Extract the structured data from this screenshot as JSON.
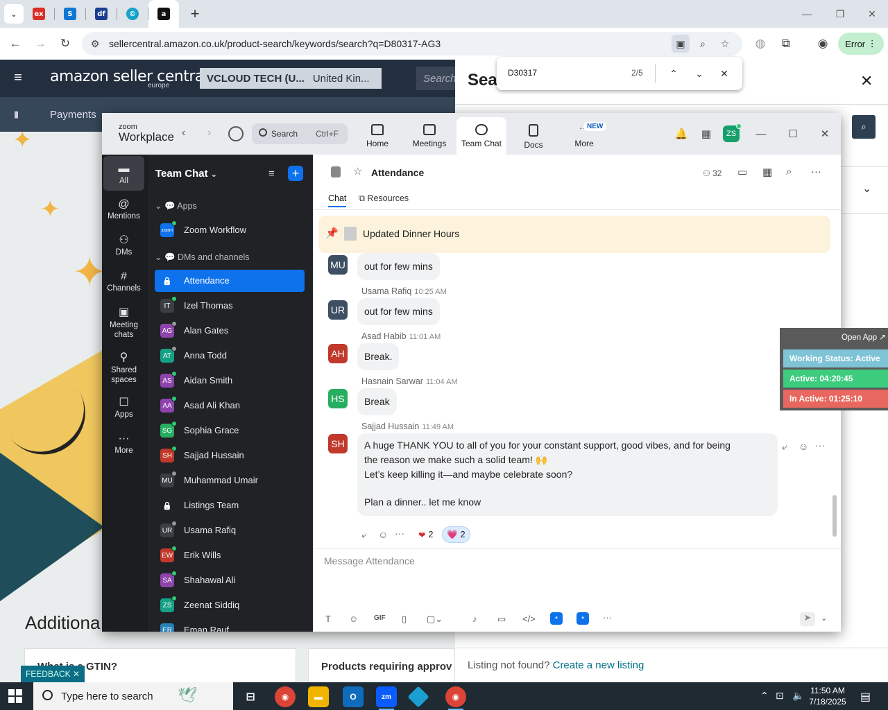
{
  "browser": {
    "tabs": [
      "ex",
      "sharepoint",
      "df",
      "copilot",
      "a"
    ],
    "new_tab": "+",
    "url": "sellercentral.amazon.co.uk/product-search/keywords/search?q=D80317-AG3",
    "error_label": "Error",
    "find": {
      "query": "D30317",
      "count": "2/5"
    }
  },
  "amazon": {
    "logo": "amazon seller central",
    "logo_sub": "europe",
    "account": "VCLOUD TECH (U...",
    "marketplace": "United Kin...",
    "search_placeholder": "Search",
    "nav_first": "Payments",
    "panel_title": "Sear",
    "additional": "Additiona",
    "card1": "What is a GTIN?",
    "card2": "Products requiring approv",
    "feedback": "FEEDBACK",
    "not_found": "Listing not found?",
    "create_link": "Create a new listing"
  },
  "zoom": {
    "brand_top": "zoom",
    "brand": "Workplace",
    "search_label": "Search",
    "search_shortcut": "Ctrl+F",
    "tabs": [
      {
        "label": "Home",
        "icon": "home-icon"
      },
      {
        "label": "Meetings",
        "icon": "video-icon"
      },
      {
        "label": "Team Chat",
        "icon": "chat-icon"
      },
      {
        "label": "Docs",
        "icon": "doc-icon"
      },
      {
        "label": "More",
        "icon": "more-icon"
      }
    ],
    "new_badge": "NEW",
    "user_initials": "ZS",
    "rail": [
      {
        "label": "All",
        "icon": "chat-bubble-icon"
      },
      {
        "label": "Mentions",
        "icon": "at-icon"
      },
      {
        "label": "DMs",
        "icon": "people-icon"
      },
      {
        "label": "Channels",
        "icon": "hash-icon"
      },
      {
        "label": "Meeting chats",
        "icon": "calendar-chat-icon"
      },
      {
        "label": "Shared spaces",
        "icon": "shared-icon"
      },
      {
        "label": "Apps",
        "icon": "apps-icon"
      },
      {
        "label": "More",
        "icon": "ellipsis-icon"
      }
    ],
    "sidebar": {
      "title": "Team Chat",
      "apps_section": "Apps",
      "dms_section": "DMs and channels",
      "apps": [
        {
          "label": "Zoom Workflow",
          "initials": "zoom",
          "color": "#0e72ed"
        }
      ],
      "items": [
        {
          "label": "Attendance",
          "initials": "",
          "color": "#0e72ed",
          "status": "",
          "active": true
        },
        {
          "label": "Izel Thomas",
          "initials": "IT",
          "color": "#3a3d42",
          "status": "#2ecc71"
        },
        {
          "label": "Alan Gates",
          "initials": "AG",
          "color": "#8e44ad",
          "status": "#999999"
        },
        {
          "label": "Anna Todd",
          "initials": "AT",
          "color": "#16a085",
          "status": "#999999"
        },
        {
          "label": "Aidan Smith",
          "initials": "AS",
          "color": "#8e44ad",
          "status": "#2ecc71"
        },
        {
          "label": "Asad Ali Khan",
          "initials": "AA",
          "color": "#8e44ad",
          "status": "#2ecc71"
        },
        {
          "label": "Sophia Grace",
          "initials": "SG",
          "color": "#27ae60",
          "status": "#2ecc71"
        },
        {
          "label": "Sajjad Hussain",
          "initials": "SH",
          "color": "#c0392b",
          "status": "#2ecc71"
        },
        {
          "label": "Muhammad Umair",
          "initials": "MU",
          "color": "#3a3d42",
          "status": "#999999"
        },
        {
          "label": "Listings Team",
          "initials": "",
          "color": "#3a3d42",
          "status": ""
        },
        {
          "label": "Usama Rafiq",
          "initials": "UR",
          "color": "#3a3d42",
          "status": "#999999"
        },
        {
          "label": "Erik Wills",
          "initials": "EW",
          "color": "#c0392b",
          "status": "#2ecc71"
        },
        {
          "label": "Shahawal Ali",
          "initials": "SA",
          "color": "#8e44ad",
          "status": "#2ecc71"
        },
        {
          "label": "Zeenat Siddiq",
          "initials": "ZS",
          "color": "#16a085",
          "status": "#2ecc71"
        },
        {
          "label": "Eman Rauf",
          "initials": "ER",
          "color": "#2980b9",
          "status": ""
        }
      ]
    },
    "chat": {
      "title": "Attendance",
      "member_count": "32",
      "tab_chat": "Chat",
      "tab_resources": "Resources",
      "pinned": "Updated Dinner Hours",
      "messages": [
        {
          "initials": "MU",
          "color": "#3d4f63",
          "name": "",
          "time": "",
          "text": "out for few mins"
        },
        {
          "initials": "UR",
          "color": "#3d4f63",
          "name": "Usama Rafiq",
          "time": "10:25 AM",
          "text": "out for few mins"
        },
        {
          "initials": "AH",
          "color": "#c0392b",
          "name": "Asad Habib",
          "time": "11:01 AM",
          "text": "Break."
        },
        {
          "initials": "HS",
          "color": "#27ae60",
          "name": "Hasnain Sarwar",
          "time": "11:04 AM",
          "text": "Break"
        },
        {
          "initials": "SH",
          "color": "#c0392b",
          "name": "Sajjad Hussain",
          "time": "11:49 AM",
          "lines": [
            "A huge THANK YOU to all of you for your constant support, good vibes, and for being",
            "the reason we make such a solid team! 🙌",
            "Let’s keep killing it—and maybe celebrate soon?",
            "",
            "Plan a dinner.. let me know"
          ]
        }
      ],
      "reactions": [
        {
          "emoji": "❤",
          "count": "2",
          "color": "#d32f2f"
        },
        {
          "emoji": "💗",
          "count": "2",
          "color": "#e0407a"
        }
      ],
      "composer_placeholder": "Message Attendance"
    }
  },
  "widget": {
    "open_app": "Open App ↗",
    "working_status": "Working Status: Active",
    "active": "Active: 04:20:45",
    "inactive": "In Active: 01:25:10"
  },
  "taskbar": {
    "search_placeholder": "Type here to search",
    "time": "11:50 AM",
    "date": "7/18/2025"
  }
}
